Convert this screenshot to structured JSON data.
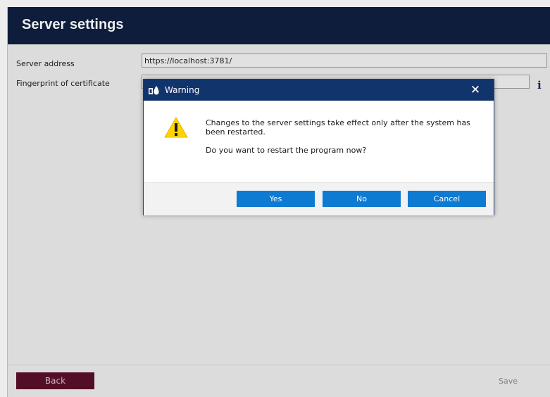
{
  "header": {
    "title": "Server settings"
  },
  "form": {
    "server_address_label": "Server address",
    "server_address_value": "https://localhost:3781/",
    "fingerprint_label": "Fingerprint of certificate",
    "fingerprint_value": "",
    "info_icon": "i"
  },
  "footer": {
    "back_label": "Back",
    "save_label": "Save"
  },
  "dialog": {
    "title": "Warning",
    "close_glyph": "✕",
    "message_1": "Changes to the server settings take effect only after the system has been restarted.",
    "message_2": "Do you want to restart the program now?",
    "yes_label": "Yes",
    "no_label": "No",
    "cancel_label": "Cancel",
    "icons": {
      "title_icon": "app-icon",
      "body_icon": "warning-icon"
    }
  },
  "colors": {
    "header_bg": "#0f2040",
    "dialog_title_bg": "#12346c",
    "button_blue": "#0e7ad1",
    "back_button": "#5a0e2b",
    "warning_yellow": "#ffd400"
  }
}
